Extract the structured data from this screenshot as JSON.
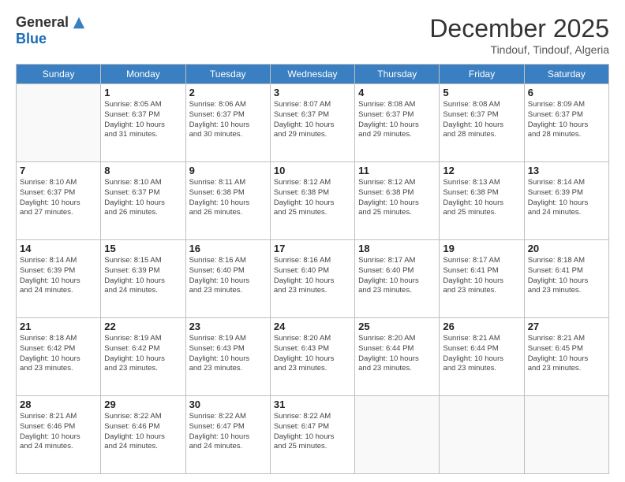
{
  "header": {
    "logo_general": "General",
    "logo_blue": "Blue",
    "month_title": "December 2025",
    "subtitle": "Tindouf, Tindouf, Algeria"
  },
  "columns": [
    "Sunday",
    "Monday",
    "Tuesday",
    "Wednesday",
    "Thursday",
    "Friday",
    "Saturday"
  ],
  "weeks": [
    [
      {
        "num": "",
        "info": ""
      },
      {
        "num": "1",
        "info": "Sunrise: 8:05 AM\nSunset: 6:37 PM\nDaylight: 10 hours\nand 31 minutes."
      },
      {
        "num": "2",
        "info": "Sunrise: 8:06 AM\nSunset: 6:37 PM\nDaylight: 10 hours\nand 30 minutes."
      },
      {
        "num": "3",
        "info": "Sunrise: 8:07 AM\nSunset: 6:37 PM\nDaylight: 10 hours\nand 29 minutes."
      },
      {
        "num": "4",
        "info": "Sunrise: 8:08 AM\nSunset: 6:37 PM\nDaylight: 10 hours\nand 29 minutes."
      },
      {
        "num": "5",
        "info": "Sunrise: 8:08 AM\nSunset: 6:37 PM\nDaylight: 10 hours\nand 28 minutes."
      },
      {
        "num": "6",
        "info": "Sunrise: 8:09 AM\nSunset: 6:37 PM\nDaylight: 10 hours\nand 28 minutes."
      }
    ],
    [
      {
        "num": "7",
        "info": "Sunrise: 8:10 AM\nSunset: 6:37 PM\nDaylight: 10 hours\nand 27 minutes."
      },
      {
        "num": "8",
        "info": "Sunrise: 8:10 AM\nSunset: 6:37 PM\nDaylight: 10 hours\nand 26 minutes."
      },
      {
        "num": "9",
        "info": "Sunrise: 8:11 AM\nSunset: 6:38 PM\nDaylight: 10 hours\nand 26 minutes."
      },
      {
        "num": "10",
        "info": "Sunrise: 8:12 AM\nSunset: 6:38 PM\nDaylight: 10 hours\nand 25 minutes."
      },
      {
        "num": "11",
        "info": "Sunrise: 8:12 AM\nSunset: 6:38 PM\nDaylight: 10 hours\nand 25 minutes."
      },
      {
        "num": "12",
        "info": "Sunrise: 8:13 AM\nSunset: 6:38 PM\nDaylight: 10 hours\nand 25 minutes."
      },
      {
        "num": "13",
        "info": "Sunrise: 8:14 AM\nSunset: 6:39 PM\nDaylight: 10 hours\nand 24 minutes."
      }
    ],
    [
      {
        "num": "14",
        "info": "Sunrise: 8:14 AM\nSunset: 6:39 PM\nDaylight: 10 hours\nand 24 minutes."
      },
      {
        "num": "15",
        "info": "Sunrise: 8:15 AM\nSunset: 6:39 PM\nDaylight: 10 hours\nand 24 minutes."
      },
      {
        "num": "16",
        "info": "Sunrise: 8:16 AM\nSunset: 6:40 PM\nDaylight: 10 hours\nand 23 minutes."
      },
      {
        "num": "17",
        "info": "Sunrise: 8:16 AM\nSunset: 6:40 PM\nDaylight: 10 hours\nand 23 minutes."
      },
      {
        "num": "18",
        "info": "Sunrise: 8:17 AM\nSunset: 6:40 PM\nDaylight: 10 hours\nand 23 minutes."
      },
      {
        "num": "19",
        "info": "Sunrise: 8:17 AM\nSunset: 6:41 PM\nDaylight: 10 hours\nand 23 minutes."
      },
      {
        "num": "20",
        "info": "Sunrise: 8:18 AM\nSunset: 6:41 PM\nDaylight: 10 hours\nand 23 minutes."
      }
    ],
    [
      {
        "num": "21",
        "info": "Sunrise: 8:18 AM\nSunset: 6:42 PM\nDaylight: 10 hours\nand 23 minutes."
      },
      {
        "num": "22",
        "info": "Sunrise: 8:19 AM\nSunset: 6:42 PM\nDaylight: 10 hours\nand 23 minutes."
      },
      {
        "num": "23",
        "info": "Sunrise: 8:19 AM\nSunset: 6:43 PM\nDaylight: 10 hours\nand 23 minutes."
      },
      {
        "num": "24",
        "info": "Sunrise: 8:20 AM\nSunset: 6:43 PM\nDaylight: 10 hours\nand 23 minutes."
      },
      {
        "num": "25",
        "info": "Sunrise: 8:20 AM\nSunset: 6:44 PM\nDaylight: 10 hours\nand 23 minutes."
      },
      {
        "num": "26",
        "info": "Sunrise: 8:21 AM\nSunset: 6:44 PM\nDaylight: 10 hours\nand 23 minutes."
      },
      {
        "num": "27",
        "info": "Sunrise: 8:21 AM\nSunset: 6:45 PM\nDaylight: 10 hours\nand 23 minutes."
      }
    ],
    [
      {
        "num": "28",
        "info": "Sunrise: 8:21 AM\nSunset: 6:46 PM\nDaylight: 10 hours\nand 24 minutes."
      },
      {
        "num": "29",
        "info": "Sunrise: 8:22 AM\nSunset: 6:46 PM\nDaylight: 10 hours\nand 24 minutes."
      },
      {
        "num": "30",
        "info": "Sunrise: 8:22 AM\nSunset: 6:47 PM\nDaylight: 10 hours\nand 24 minutes."
      },
      {
        "num": "31",
        "info": "Sunrise: 8:22 AM\nSunset: 6:47 PM\nDaylight: 10 hours\nand 25 minutes."
      },
      {
        "num": "",
        "info": ""
      },
      {
        "num": "",
        "info": ""
      },
      {
        "num": "",
        "info": ""
      }
    ]
  ]
}
